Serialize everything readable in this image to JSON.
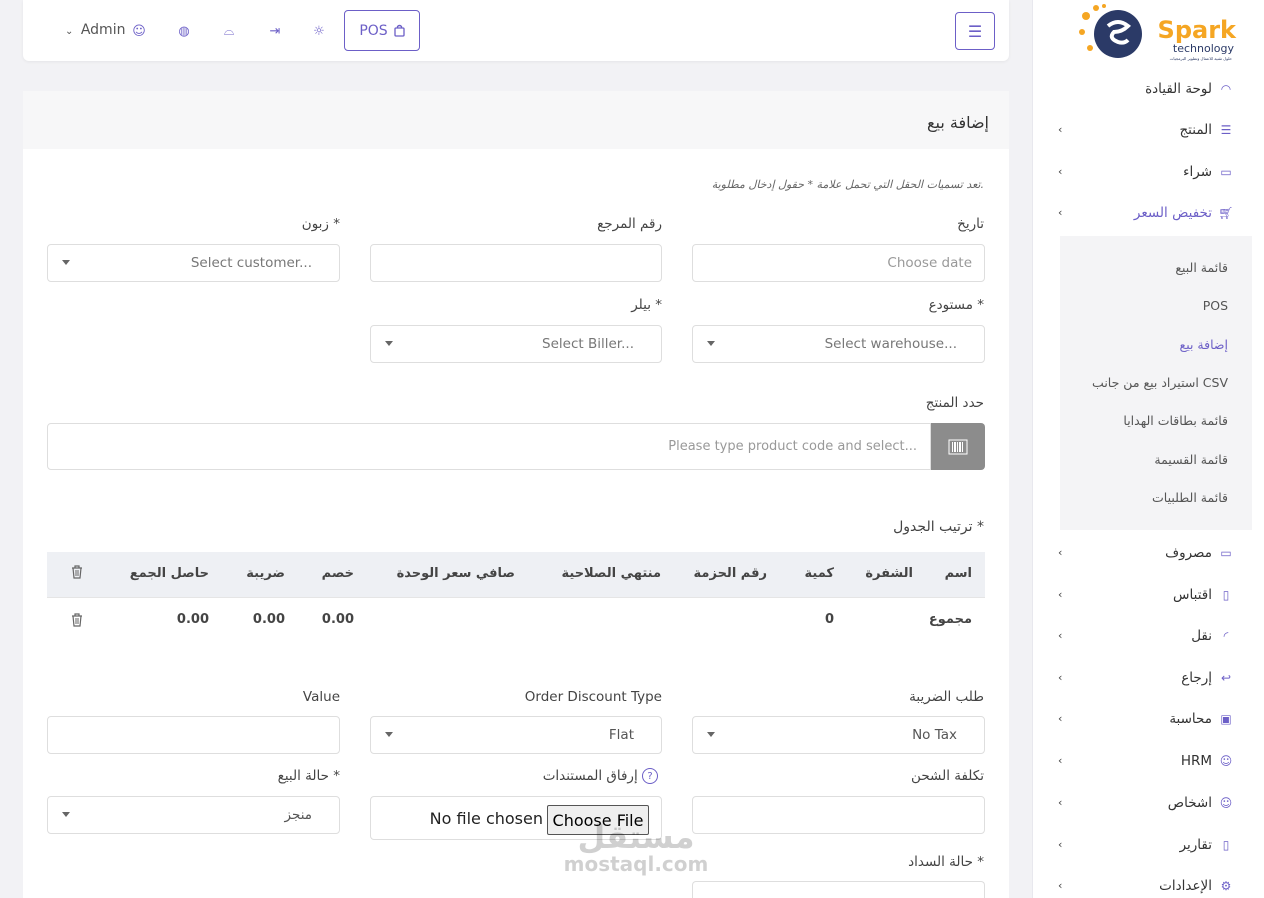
{
  "brand": {
    "name": "Spark",
    "sub": "technology",
    "tag": "حلول تقنية للاعمال وتطوير البرمجيات"
  },
  "topbar": {
    "pos_label": "POS",
    "admin_label": "Admin"
  },
  "sidebar": {
    "items": [
      {
        "label": "لوحة القيادة"
      },
      {
        "label": "المنتج"
      },
      {
        "label": "شراء"
      },
      {
        "label": "تخفيض السعر"
      },
      {
        "label": "مصروف"
      },
      {
        "label": "اقتباس"
      },
      {
        "label": "نقل"
      },
      {
        "label": "إرجاع"
      },
      {
        "label": "محاسبة"
      },
      {
        "label": "HRM"
      },
      {
        "label": "اشخاص"
      },
      {
        "label": "تقارير"
      },
      {
        "label": "الإعدادات"
      }
    ],
    "submenu": [
      {
        "label": "قائمة البيع"
      },
      {
        "label": "POS"
      },
      {
        "label": "إضافة بيع"
      },
      {
        "label": "استيراد بيع من جانب CSV"
      },
      {
        "label": "قائمة بطاقات الهدايا"
      },
      {
        "label": "قائمة القسيمة"
      },
      {
        "label": "قائمة الطلبيات"
      }
    ]
  },
  "form": {
    "title": "إضافة بيع",
    "note": "تعد تسميات الحقل التي تحمل علامة * حقول إدخال مطلوبة.",
    "date_label": "تاريخ",
    "date_placeholder": "Choose date",
    "ref_label": "رقم المرجع",
    "customer_label": "زبون *",
    "customer_placeholder": "Select customer...",
    "warehouse_label": "مستودع *",
    "warehouse_placeholder": "Select warehouse...",
    "biller_label": "بيلر *",
    "biller_placeholder": "Select Biller...",
    "product_label": "حدد المنتج",
    "product_placeholder": "Please type product code and select...",
    "order_table_label": "ترتيب الجدول *",
    "tax_label": "طلب الضريبة",
    "tax_value": "No Tax",
    "discount_type_label": "Order Discount Type",
    "discount_type_value": "Flat",
    "value_label": "Value",
    "shipping_label": "تكلفة الشحن",
    "attach_label": "إرفاق المستندات",
    "file_button": "Choose File",
    "file_none": "No file chosen",
    "sale_status_label": "حالة البيع *",
    "sale_status_value": "منجز",
    "payment_status_label": "حالة السداد *"
  },
  "table": {
    "headers": [
      "اسم",
      "الشفرة",
      "كمية",
      "رقم الحزمة",
      "منتهي الصلاحية",
      "صافي سعر الوحدة",
      "خصم",
      "ضريبة",
      "حاصل الجمع"
    ],
    "total_row": {
      "label": "مجموع",
      "qty": "0",
      "discount": "0.00",
      "tax": "0.00",
      "subtotal": "0.00"
    }
  },
  "watermark": {
    "line1": "مستقل",
    "line2": "mostaql.com"
  }
}
